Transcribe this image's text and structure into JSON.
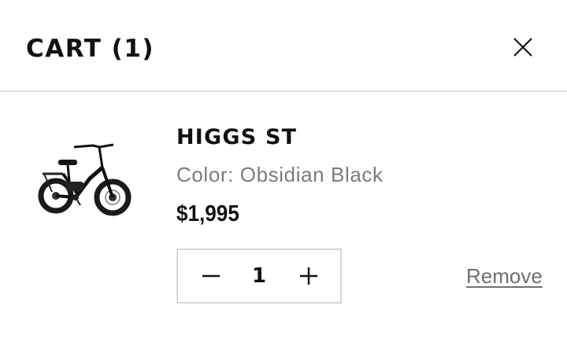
{
  "header": {
    "title": "CART (1)",
    "close_icon": "close-icon"
  },
  "cart": {
    "items": [
      {
        "name": "HIGGS ST",
        "color": "Color: Obsidian Black",
        "price": "$1,995",
        "quantity": "1",
        "remove_label": "Remove",
        "image_icon": "e-bike-image"
      }
    ]
  },
  "colors": {
    "text": "#111111",
    "muted": "#7c7c7c",
    "border": "#d6d6d6"
  }
}
